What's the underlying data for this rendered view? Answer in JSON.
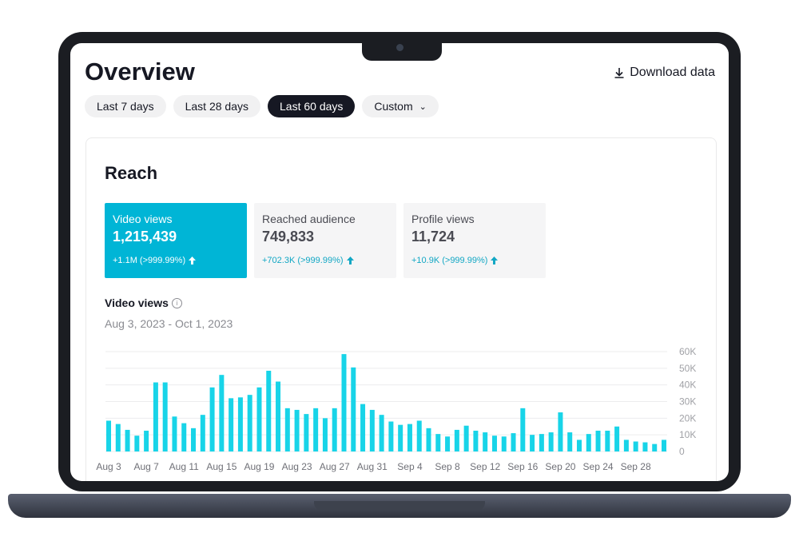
{
  "page": {
    "title": "Overview",
    "download_label": "Download data"
  },
  "date_filters": [
    {
      "label": "Last 7 days",
      "active": false
    },
    {
      "label": "Last 28 days",
      "active": false
    },
    {
      "label": "Last 60 days",
      "active": true
    },
    {
      "label": "Custom",
      "active": false
    }
  ],
  "card": {
    "title": "Reach"
  },
  "metrics": [
    {
      "label": "Video views",
      "value": "1,215,439",
      "delta": "+1.1M  (>999.99%)",
      "selected": true
    },
    {
      "label": "Reached audience",
      "value": "749,833",
      "delta": "+702.3K  (>999.99%)",
      "selected": false
    },
    {
      "label": "Profile views",
      "value": "11,724",
      "delta": "+10.9K  (>999.99%)",
      "selected": false
    }
  ],
  "chart_header": {
    "title": "Video views",
    "date_range": "Aug 3, 2023 - Oct 1, 2023"
  },
  "colors": {
    "accent": "#00b5d6",
    "bar": "#18d4e8",
    "dark": "#161823"
  },
  "chart_data": {
    "type": "bar",
    "title": "Video views",
    "x_ticks": [
      "Aug 3",
      "Aug 7",
      "Aug 11",
      "Aug 15",
      "Aug 19",
      "Aug 23",
      "Aug 27",
      "Aug 31",
      "Sep 4",
      "Sep 8",
      "Sep 12",
      "Sep 16",
      "Sep 20",
      "Sep 24",
      "Sep 28"
    ],
    "y_ticks": [
      "0",
      "10K",
      "20K",
      "30K",
      "40K",
      "50K",
      "60K"
    ],
    "ylim": [
      0,
      60000
    ],
    "grid": true,
    "y_axis_position": "right",
    "values": [
      18500,
      16500,
      13000,
      9500,
      12500,
      41500,
      41500,
      21000,
      17000,
      14000,
      22000,
      38500,
      46000,
      32000,
      32500,
      34000,
      38500,
      48500,
      42000,
      26000,
      25000,
      22500,
      26000,
      20000,
      26000,
      58500,
      50500,
      28500,
      25000,
      22000,
      18000,
      16000,
      16500,
      18500,
      14000,
      10500,
      9000,
      13000,
      15500,
      12500,
      11500,
      9500,
      9000,
      11000,
      26000,
      10000,
      10500,
      11500,
      23500,
      11500,
      7000,
      10500,
      12500,
      12500,
      15000,
      7000,
      6000,
      5500,
      4500,
      7000
    ]
  }
}
